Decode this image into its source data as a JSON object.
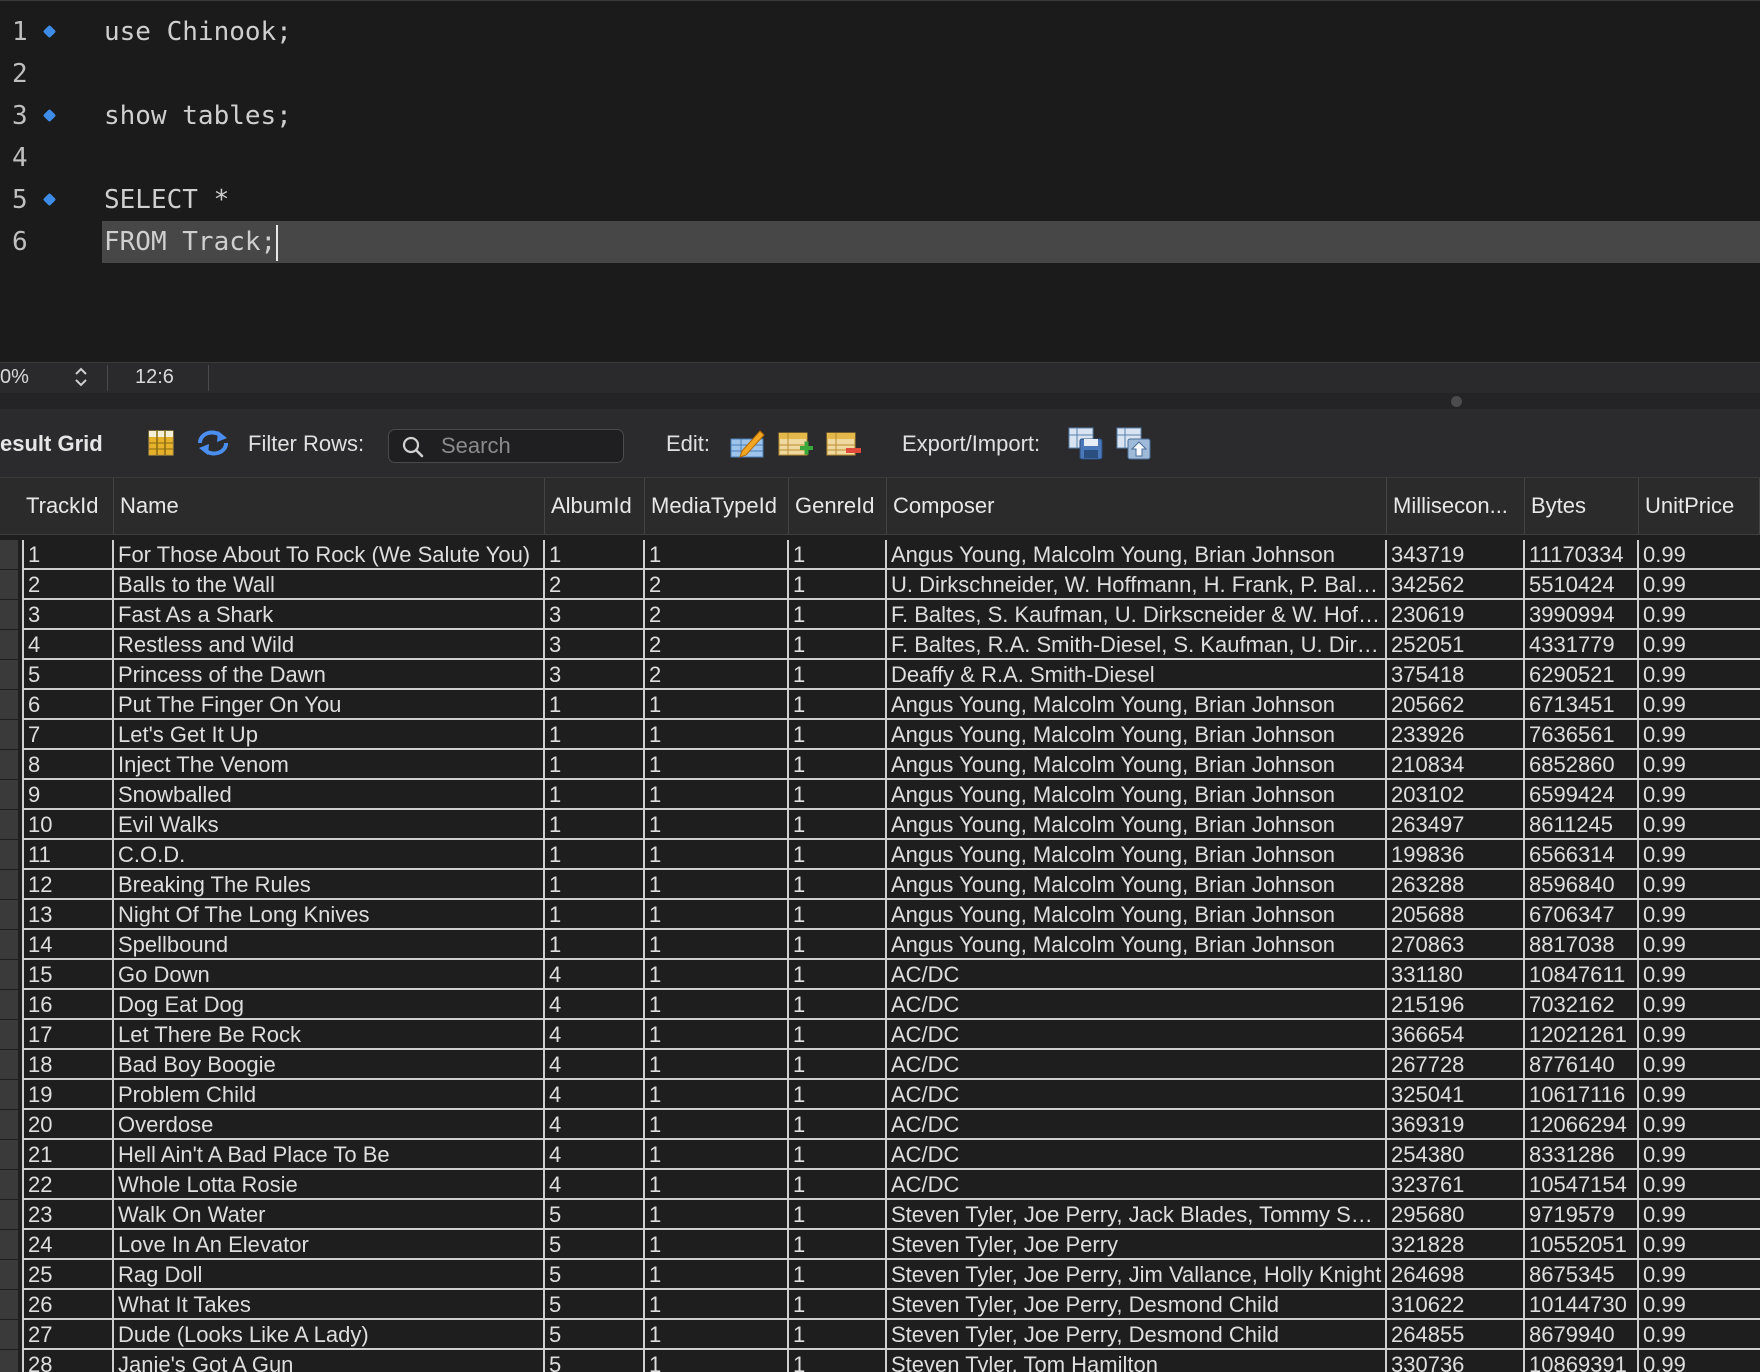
{
  "editor": {
    "lines": [
      {
        "num": "1",
        "text": "use Chinook;",
        "marker": true
      },
      {
        "num": "2",
        "text": "",
        "marker": false
      },
      {
        "num": "3",
        "text": "show tables;",
        "marker": true
      },
      {
        "num": "4",
        "text": "",
        "marker": false
      },
      {
        "num": "5",
        "text": "SELECT *",
        "marker": true
      },
      {
        "num": "6",
        "text": "FROM Track;",
        "marker": false
      }
    ]
  },
  "status": {
    "zoom": "0%",
    "cursor_position": "12:6"
  },
  "toolbar": {
    "result_grid_label": "esult Grid",
    "filter_rows_label": "Filter Rows:",
    "search_placeholder": "Search",
    "edit_label": "Edit:",
    "export_import_label": "Export/Import:"
  },
  "grid": {
    "columns": [
      "TrackId",
      "Name",
      "AlbumId",
      "MediaTypeId",
      "GenreId",
      "Composer",
      "Millisecon...",
      "Bytes",
      "UnitPrice"
    ],
    "rows": [
      [
        "1",
        "For Those About To Rock (We Salute You)",
        "1",
        "1",
        "1",
        "Angus Young, Malcolm Young, Brian Johnson",
        "343719",
        "11170334",
        "0.99"
      ],
      [
        "2",
        "Balls to the Wall",
        "2",
        "2",
        "1",
        "U. Dirkschneider, W. Hoffmann, H. Frank, P. Bal…",
        "342562",
        "5510424",
        "0.99"
      ],
      [
        "3",
        "Fast As a Shark",
        "3",
        "2",
        "1",
        "F. Baltes, S. Kaufman, U. Dirkscneider & W. Hof…",
        "230619",
        "3990994",
        "0.99"
      ],
      [
        "4",
        "Restless and Wild",
        "3",
        "2",
        "1",
        "F. Baltes, R.A. Smith-Diesel, S. Kaufman, U. Dir…",
        "252051",
        "4331779",
        "0.99"
      ],
      [
        "5",
        "Princess of the Dawn",
        "3",
        "2",
        "1",
        "Deaffy & R.A. Smith-Diesel",
        "375418",
        "6290521",
        "0.99"
      ],
      [
        "6",
        "Put The Finger On You",
        "1",
        "1",
        "1",
        "Angus Young, Malcolm Young, Brian Johnson",
        "205662",
        "6713451",
        "0.99"
      ],
      [
        "7",
        "Let's Get It Up",
        "1",
        "1",
        "1",
        "Angus Young, Malcolm Young, Brian Johnson",
        "233926",
        "7636561",
        "0.99"
      ],
      [
        "8",
        "Inject The Venom",
        "1",
        "1",
        "1",
        "Angus Young, Malcolm Young, Brian Johnson",
        "210834",
        "6852860",
        "0.99"
      ],
      [
        "9",
        "Snowballed",
        "1",
        "1",
        "1",
        "Angus Young, Malcolm Young, Brian Johnson",
        "203102",
        "6599424",
        "0.99"
      ],
      [
        "10",
        "Evil Walks",
        "1",
        "1",
        "1",
        "Angus Young, Malcolm Young, Brian Johnson",
        "263497",
        "8611245",
        "0.99"
      ],
      [
        "11",
        "C.O.D.",
        "1",
        "1",
        "1",
        "Angus Young, Malcolm Young, Brian Johnson",
        "199836",
        "6566314",
        "0.99"
      ],
      [
        "12",
        "Breaking The Rules",
        "1",
        "1",
        "1",
        "Angus Young, Malcolm Young, Brian Johnson",
        "263288",
        "8596840",
        "0.99"
      ],
      [
        "13",
        "Night Of The Long Knives",
        "1",
        "1",
        "1",
        "Angus Young, Malcolm Young, Brian Johnson",
        "205688",
        "6706347",
        "0.99"
      ],
      [
        "14",
        "Spellbound",
        "1",
        "1",
        "1",
        "Angus Young, Malcolm Young, Brian Johnson",
        "270863",
        "8817038",
        "0.99"
      ],
      [
        "15",
        "Go Down",
        "4",
        "1",
        "1",
        "AC/DC",
        "331180",
        "10847611",
        "0.99"
      ],
      [
        "16",
        "Dog Eat Dog",
        "4",
        "1",
        "1",
        "AC/DC",
        "215196",
        "7032162",
        "0.99"
      ],
      [
        "17",
        "Let There Be Rock",
        "4",
        "1",
        "1",
        "AC/DC",
        "366654",
        "12021261",
        "0.99"
      ],
      [
        "18",
        "Bad Boy Boogie",
        "4",
        "1",
        "1",
        "AC/DC",
        "267728",
        "8776140",
        "0.99"
      ],
      [
        "19",
        "Problem Child",
        "4",
        "1",
        "1",
        "AC/DC",
        "325041",
        "10617116",
        "0.99"
      ],
      [
        "20",
        "Overdose",
        "4",
        "1",
        "1",
        "AC/DC",
        "369319",
        "12066294",
        "0.99"
      ],
      [
        "21",
        "Hell Ain't A Bad Place To Be",
        "4",
        "1",
        "1",
        "AC/DC",
        "254380",
        "8331286",
        "0.99"
      ],
      [
        "22",
        "Whole Lotta Rosie",
        "4",
        "1",
        "1",
        "AC/DC",
        "323761",
        "10547154",
        "0.99"
      ],
      [
        "23",
        "Walk On Water",
        "5",
        "1",
        "1",
        "Steven Tyler, Joe Perry, Jack Blades, Tommy S…",
        "295680",
        "9719579",
        "0.99"
      ],
      [
        "24",
        "Love In An Elevator",
        "5",
        "1",
        "1",
        "Steven Tyler, Joe Perry",
        "321828",
        "10552051",
        "0.99"
      ],
      [
        "25",
        "Rag Doll",
        "5",
        "1",
        "1",
        "Steven Tyler, Joe Perry, Jim Vallance, Holly Knight",
        "264698",
        "8675345",
        "0.99"
      ],
      [
        "26",
        "What It Takes",
        "5",
        "1",
        "1",
        "Steven Tyler, Joe Perry, Desmond Child",
        "310622",
        "10144730",
        "0.99"
      ],
      [
        "27",
        "Dude (Looks Like A Lady)",
        "5",
        "1",
        "1",
        "Steven Tyler, Joe Perry, Desmond Child",
        "264855",
        "8679940",
        "0.99"
      ],
      [
        "28",
        "Janie's Got A Gun",
        "5",
        "1",
        "1",
        "Steven Tyler, Tom Hamilton",
        "330736",
        "10869391",
        "0.99"
      ]
    ]
  }
}
